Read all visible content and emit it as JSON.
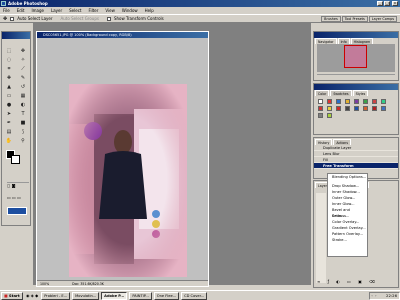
{
  "window": {
    "title": "Adobe Photoshop",
    "min": "_",
    "max": "□",
    "close": "x"
  },
  "menu": [
    "File",
    "Edit",
    "Image",
    "Layer",
    "Select",
    "Filter",
    "View",
    "Window",
    "Help"
  ],
  "options": {
    "auto_select_layer": "Auto Select Layer",
    "auto_select_groups": "Auto Select Groups",
    "show_transform_controls": "Show Transform Controls",
    "tabs": [
      "Brushes",
      "Tool Presets",
      "Layer Comps"
    ]
  },
  "document": {
    "title": "DSC05651.JPG @ 100% (Background copy, RGB/8)",
    "zoom": "100%",
    "doc_size": "Doc: 351.6K/820.3K"
  },
  "panels": {
    "navigator_tabs": [
      "Navigator",
      "Info",
      "Histogram"
    ],
    "color_tabs": [
      "Color",
      "Swatches",
      "Styles"
    ],
    "history_tabs": [
      "History",
      "Actions"
    ],
    "history": [
      "Duplicate Layer",
      "Lens Blur",
      "Fill",
      "Free Transform"
    ],
    "layers_tabs": [
      "Layers",
      "Channels",
      "Paths"
    ]
  },
  "context_menu": [
    "Blending Options...",
    "Drop Shadow...",
    "Inner Shadow...",
    "Outer Glow...",
    "Inner Glow...",
    "Bevel and Emboss...",
    "Satin...",
    "Color Overlay...",
    "Gradient Overlay...",
    "Pattern Overlay...",
    "Stroke..."
  ],
  "taskbar": {
    "start": "Start",
    "tasks": [
      "Probleri - E...",
      "Movulatin...",
      "Adobe P...",
      "PAINTIP...",
      "One Flee...",
      "CD Cover..."
    ],
    "clock": "22:26"
  },
  "colors": {
    "titlebar": "#0a246a",
    "workspace": "#808080",
    "chrome": "#d4d0c8",
    "photo_frame": "#d79aae"
  },
  "icons": [
    "move-icon",
    "marquee-icon",
    "lasso-icon",
    "magic-wand-icon",
    "crop-icon",
    "slice-icon",
    "healing-icon",
    "brush-icon",
    "stamp-icon",
    "history-brush-icon",
    "eraser-icon",
    "gradient-icon",
    "blur-icon",
    "dodge-icon",
    "path-select-icon",
    "type-icon",
    "pen-icon",
    "shape-icon",
    "notes-icon",
    "eyedropper-icon",
    "hand-icon",
    "zoom-icon"
  ]
}
